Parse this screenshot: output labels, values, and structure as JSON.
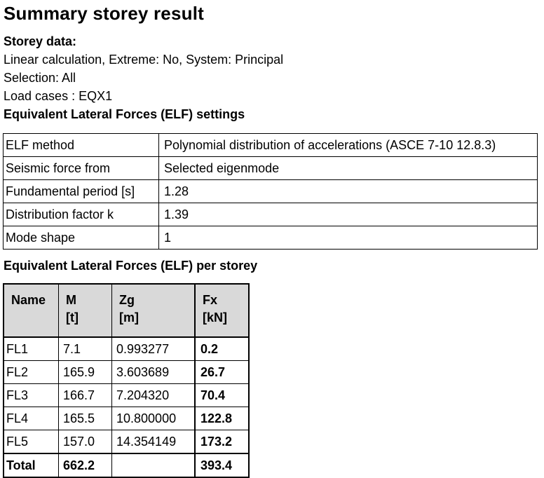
{
  "title": "Summary storey result",
  "storey_data_heading": "Storey data:",
  "calc_line": "Linear calculation, Extreme: No, System: Principal",
  "selection_line": "Selection: All",
  "load_cases_line": "Load cases : EQX1",
  "elf_settings_heading": "Equivalent Lateral Forces (ELF) settings",
  "settings": [
    {
      "key": "ELF method",
      "value": "Polynomial distribution of accelerations (ASCE 7-10 12.8.3)"
    },
    {
      "key": "Seismic force from",
      "value": "Selected eigenmode"
    },
    {
      "key": "Fundamental period [s]",
      "value": "1.28"
    },
    {
      "key": "Distribution factor k",
      "value": "1.39"
    },
    {
      "key": "Mode shape",
      "value": "1"
    }
  ],
  "elf_per_storey_heading": "Equivalent Lateral Forces (ELF) per storey",
  "columns": [
    {
      "name": "Name",
      "unit": ""
    },
    {
      "name": "M",
      "unit": "[t]"
    },
    {
      "name": "Zg",
      "unit": "[m]"
    },
    {
      "name": "Fx",
      "unit": "[kN]"
    }
  ],
  "rows": [
    {
      "name": "FL1",
      "m": "7.1",
      "zg": "0.993277",
      "fx": "0.2"
    },
    {
      "name": "FL2",
      "m": "165.9",
      "zg": "3.603689",
      "fx": "26.7"
    },
    {
      "name": "FL3",
      "m": "166.7",
      "zg": "7.204320",
      "fx": "70.4"
    },
    {
      "name": "FL4",
      "m": "165.5",
      "zg": "10.800000",
      "fx": "122.8"
    },
    {
      "name": "FL5",
      "m": "157.0",
      "zg": "14.354149",
      "fx": "173.2"
    }
  ],
  "total": {
    "name": "Total",
    "m": "662.2",
    "zg": "",
    "fx": "393.4"
  }
}
